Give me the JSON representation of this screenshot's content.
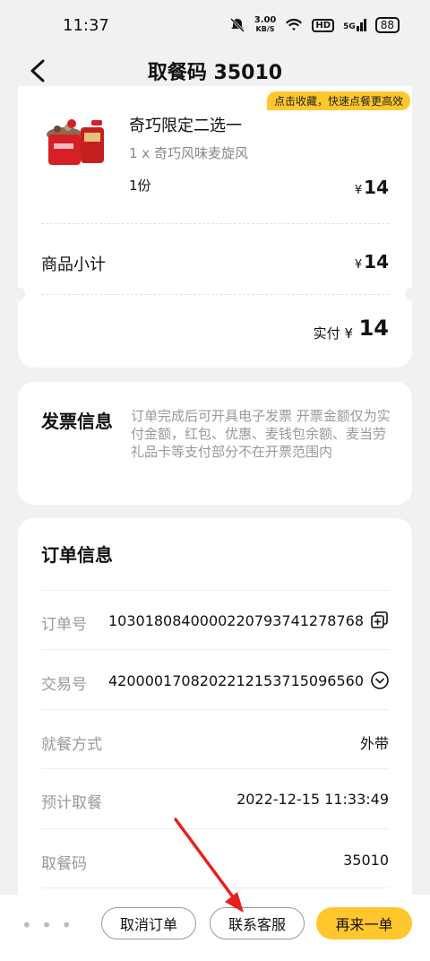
{
  "status": {
    "time": "11:37",
    "speed_value": "3.00",
    "speed_unit": "KB/S",
    "hd": "HD",
    "net": "5G",
    "battery": "88"
  },
  "header": {
    "title": "取餐码 35010"
  },
  "promo": {
    "text": "点击收藏，快速点餐更高效"
  },
  "product": {
    "name": "奇巧限定二选一",
    "sub": "1 x 奇巧风味麦旋风",
    "qty": "1份",
    "currency": "¥",
    "price": "14"
  },
  "summary": {
    "subtotal_label": "商品小计",
    "subtotal_currency": "¥",
    "subtotal_value": "14",
    "paid_label": "实付",
    "paid_currency": "¥",
    "paid_value": "14"
  },
  "invoice": {
    "title": "发票信息",
    "text": "订单完成后可开具电子发票 开票金额仅为实付金额，红包、优惠、麦钱包余额、麦当劳礼品卡等支付部分不在开票范围内"
  },
  "order": {
    "title": "订单信息",
    "rows": [
      {
        "label": "订单号",
        "value": "1030180840000220793741278768"
      },
      {
        "label": "交易号",
        "value": "4200001708202212153715096560"
      },
      {
        "label": "就餐方式",
        "value": "外带"
      },
      {
        "label": "预计取餐",
        "value": "2022-12-15 11:33:49"
      },
      {
        "label": "取餐码",
        "value": "35010"
      }
    ]
  },
  "actions": {
    "more": "• • •",
    "cancel": "取消订单",
    "service": "联系客服",
    "reorder": "再来一单"
  },
  "colors": {
    "accent": "#ffc72c",
    "annotation": "#e8201c"
  }
}
